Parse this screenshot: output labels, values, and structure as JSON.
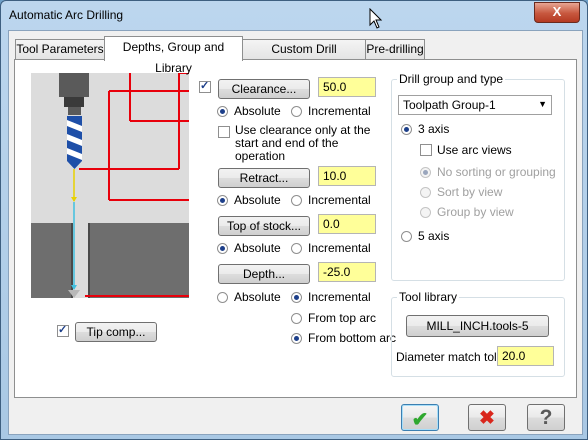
{
  "window": {
    "title": "Automatic Arc Drilling",
    "close_label": "X"
  },
  "tabs": [
    {
      "label": "Tool Parameters"
    },
    {
      "label": "Depths, Group and Library"
    },
    {
      "label": "Custom Drill Parameters"
    },
    {
      "label": "Pre-drilling"
    }
  ],
  "clearance": {
    "enabled": true,
    "button": "Clearance...",
    "value": "50.0",
    "absolute": "Absolute",
    "incremental": "Incremental",
    "mode": "absolute",
    "only_start_end_label": "Use clearance only at the start and end of the operation",
    "only_start_end": false
  },
  "retract": {
    "button": "Retract...",
    "value": "10.0",
    "absolute": "Absolute",
    "incremental": "Incremental",
    "mode": "absolute"
  },
  "top_of_stock": {
    "button": "Top of stock...",
    "value": "0.0",
    "absolute": "Absolute",
    "incremental": "Incremental",
    "mode": "absolute"
  },
  "depth": {
    "button": "Depth...",
    "value": "-25.0",
    "absolute": "Absolute",
    "incremental": "Incremental",
    "mode": "incremental",
    "from_top_arc": "From top arc",
    "from_bottom_arc": "From bottom arc",
    "from": "bottom"
  },
  "tip_comp": {
    "enabled": true,
    "button": "Tip comp..."
  },
  "drill_group": {
    "title": "Drill group and type",
    "group_value": "Toolpath Group-1",
    "axis3_label": "3 axis",
    "axis5_label": "5 axis",
    "axis": "3",
    "use_arc_views_label": "Use arc views",
    "use_arc_views": false,
    "sort_options": [
      "No sorting or grouping",
      "Sort by view",
      "Group by view"
    ],
    "sort_selected": 0
  },
  "tool_library": {
    "title": "Tool library",
    "button": "MILL_INCH.tools-5",
    "diameter_label": "Diameter match tol",
    "diameter_value": "20.0"
  },
  "footer": {
    "ok_glyph": "✔",
    "cancel_glyph": "✖",
    "help_glyph": "?"
  },
  "colors": {
    "field_bg": "#ffff99",
    "red_line": "#e8000b",
    "ok": "#2fa82f",
    "cancel": "#d9261c",
    "help": "#5a5a5a"
  }
}
